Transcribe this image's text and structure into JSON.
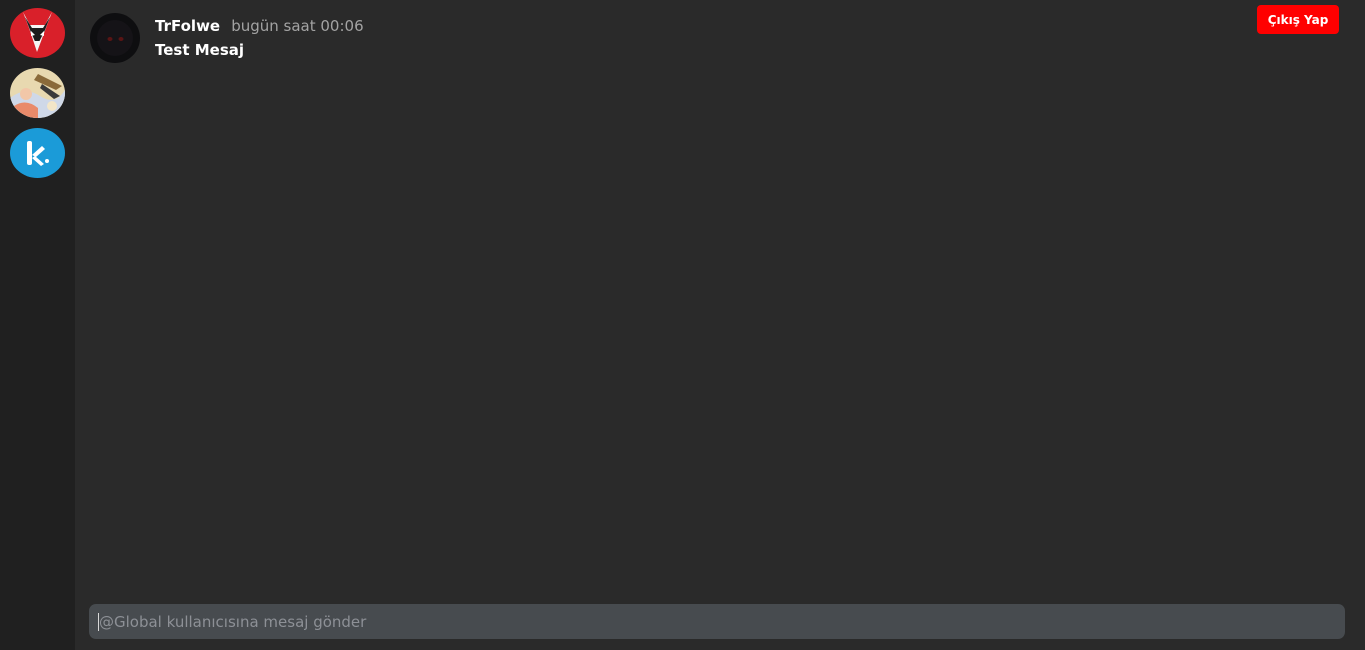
{
  "sidebar": {
    "servers": [
      {
        "icon": "fox-logo-icon",
        "color": "#d9202a"
      },
      {
        "icon": "anime-art-icon",
        "color": "#e8d9b0"
      },
      {
        "icon": "k-logo-icon",
        "color": "#1b9bd8"
      }
    ]
  },
  "header": {
    "logout_label": "Çıkış Yap",
    "logout_color": "#ff0000"
  },
  "messages": [
    {
      "username": "TrFolwe",
      "timestamp": "bugün saat 00:06",
      "text": "Test Mesaj",
      "avatar_icon": "dark-avatar-icon"
    }
  ],
  "composer": {
    "placeholder": "@Global kullanıcısına mesaj gönder",
    "value": ""
  },
  "colors": {
    "background": "#2a2a2a",
    "sidebar": "#202020",
    "input": "#474b4f"
  }
}
